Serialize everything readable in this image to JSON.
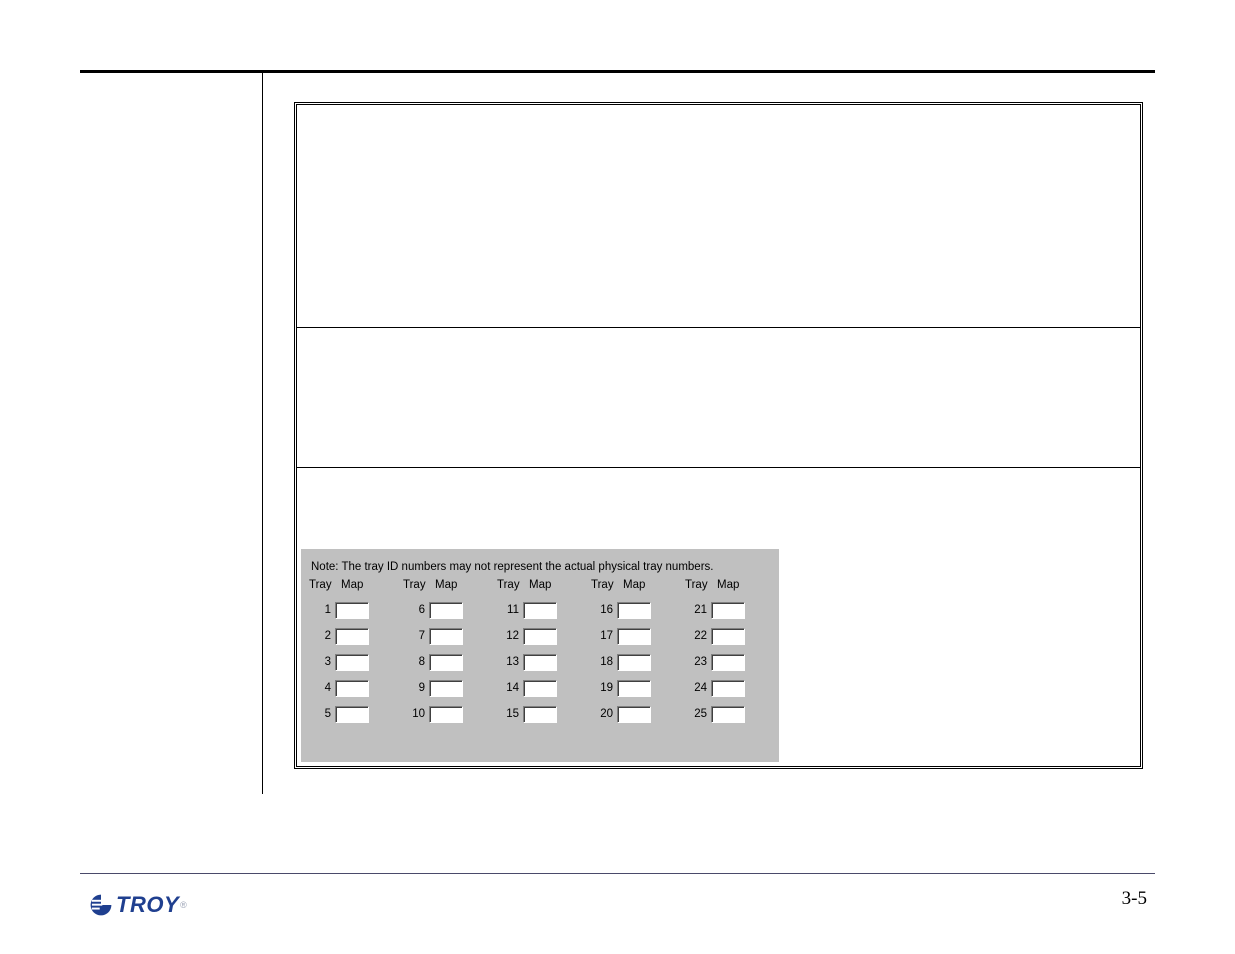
{
  "note_text": "Note: The tray ID numbers may not represent the actual physical tray numbers.",
  "headers": {
    "tray": "Tray",
    "map": "Map"
  },
  "columns": [
    {
      "rows": [
        {
          "n": "1",
          "v": ""
        },
        {
          "n": "2",
          "v": ""
        },
        {
          "n": "3",
          "v": ""
        },
        {
          "n": "4",
          "v": ""
        },
        {
          "n": "5",
          "v": ""
        }
      ]
    },
    {
      "rows": [
        {
          "n": "6",
          "v": ""
        },
        {
          "n": "7",
          "v": ""
        },
        {
          "n": "8",
          "v": ""
        },
        {
          "n": "9",
          "v": ""
        },
        {
          "n": "10",
          "v": ""
        }
      ]
    },
    {
      "rows": [
        {
          "n": "11",
          "v": ""
        },
        {
          "n": "12",
          "v": ""
        },
        {
          "n": "13",
          "v": ""
        },
        {
          "n": "14",
          "v": ""
        },
        {
          "n": "15",
          "v": ""
        }
      ]
    },
    {
      "rows": [
        {
          "n": "16",
          "v": ""
        },
        {
          "n": "17",
          "v": ""
        },
        {
          "n": "18",
          "v": ""
        },
        {
          "n": "19",
          "v": ""
        },
        {
          "n": "20",
          "v": ""
        }
      ]
    },
    {
      "rows": [
        {
          "n": "21",
          "v": ""
        },
        {
          "n": "22",
          "v": ""
        },
        {
          "n": "23",
          "v": ""
        },
        {
          "n": "24",
          "v": ""
        },
        {
          "n": "25",
          "v": ""
        }
      ]
    }
  ],
  "footer": {
    "brand": "TROY",
    "page_number": "3-5"
  }
}
